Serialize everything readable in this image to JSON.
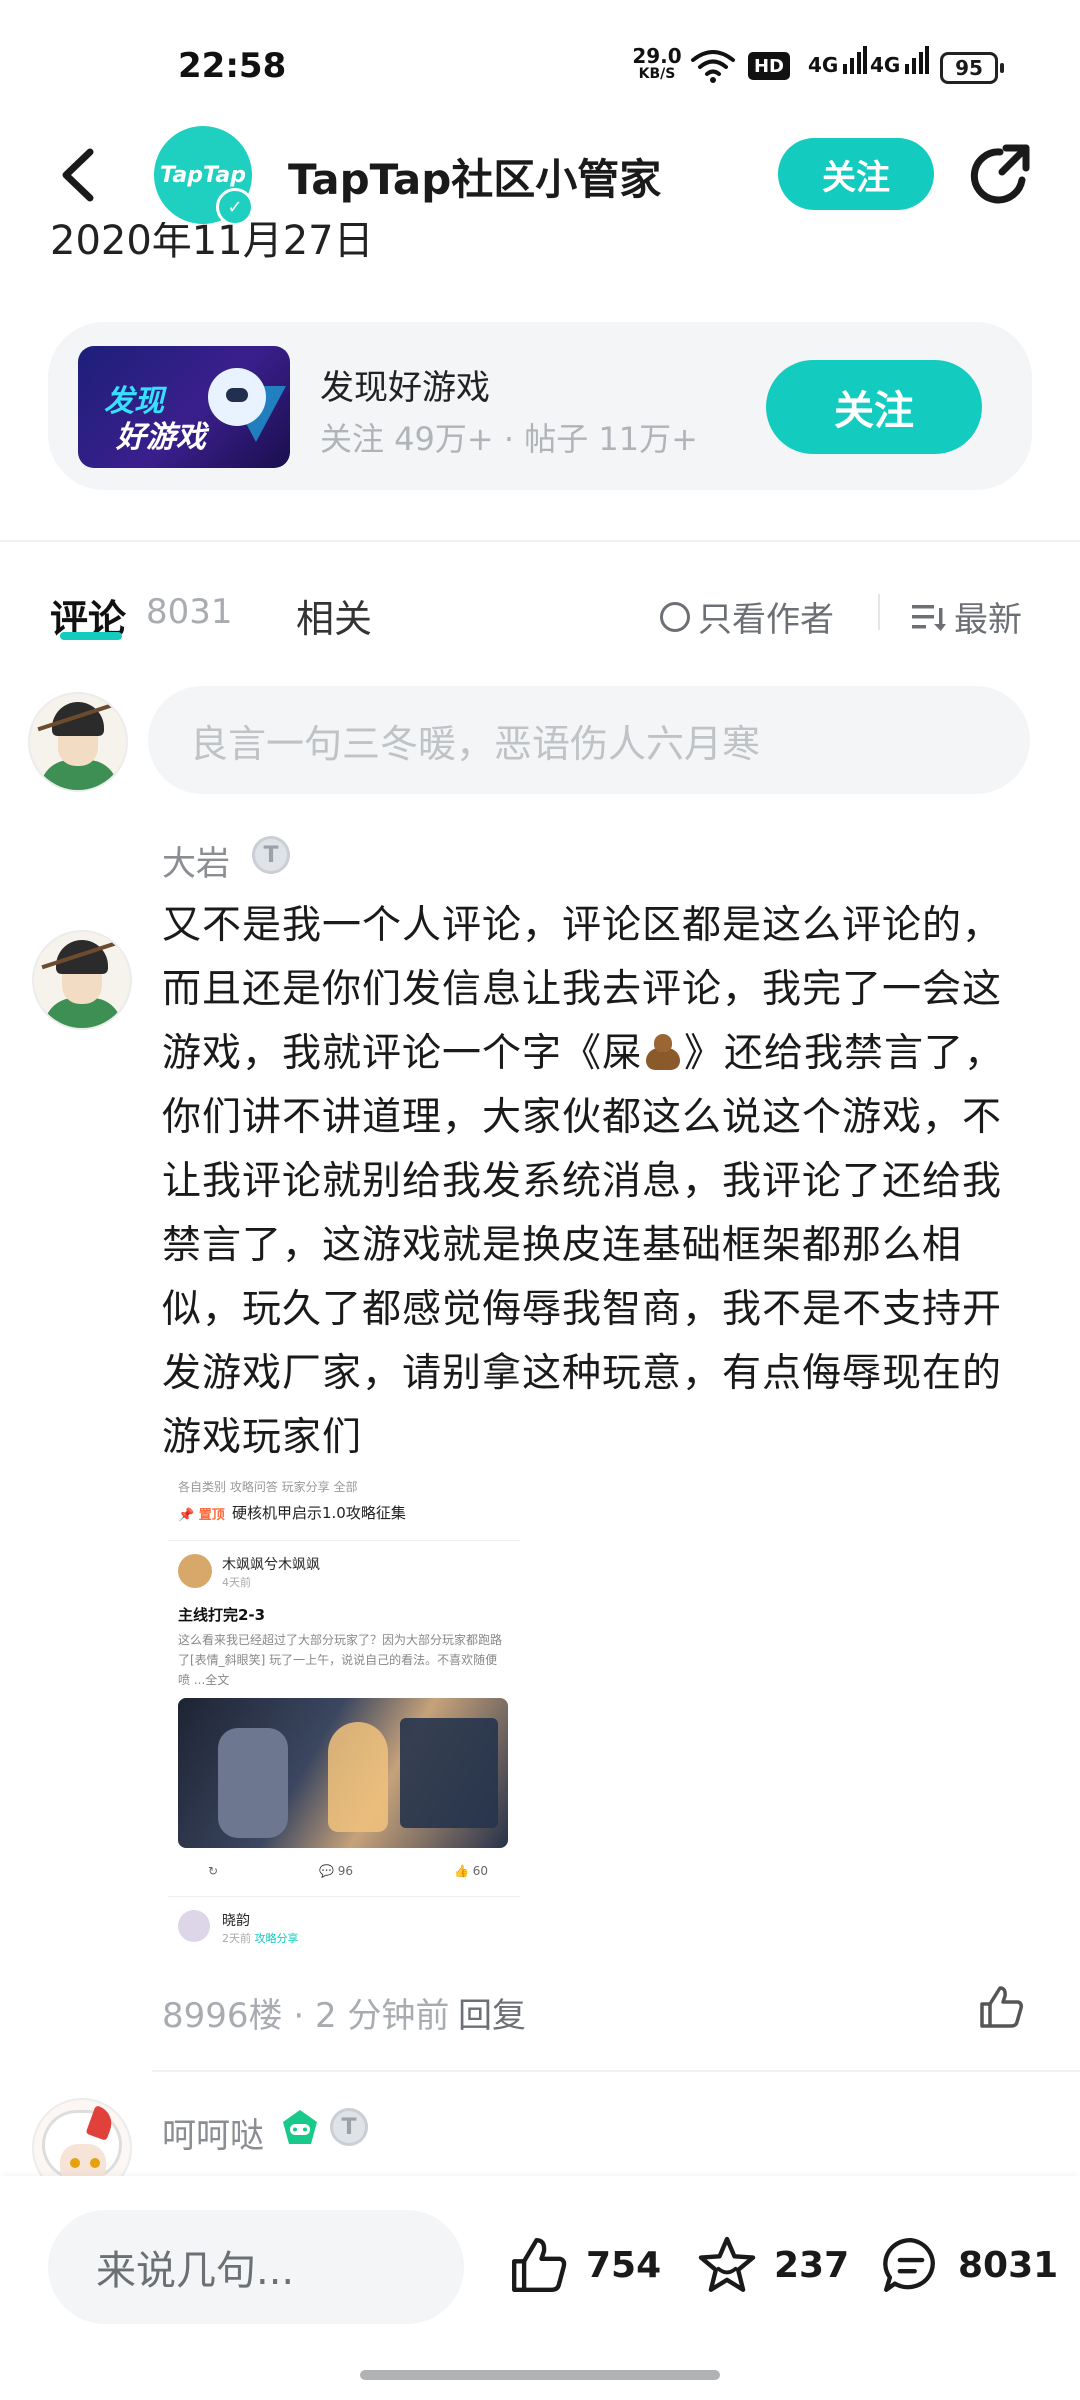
{
  "status_bar": {
    "time": "22:58",
    "net_speed": "29.0",
    "net_speed_unit": "KB/S",
    "hd_label": "HD",
    "signal_1": "4G",
    "signal_2": "4G",
    "battery": "95",
    "icons": [
      "wifi-icon",
      "signal-icon",
      "battery-icon"
    ]
  },
  "header": {
    "avatar_text": "TapTap",
    "title": "TapTap社区小管家",
    "follow_label": "关注",
    "partial_date": "2020年11月27日",
    "icons": [
      "back-arrow-icon",
      "verified-icon",
      "share-icon"
    ]
  },
  "group_card": {
    "logo_line1": "发现",
    "logo_line2": "好游戏",
    "name": "发现好游戏",
    "stats": "关注 49万+ · 帖子 11万+",
    "follow_label": "关注"
  },
  "tabs": {
    "comments_label": "评论",
    "comments_count": "8031",
    "related_label": "相关",
    "author_only_label": "只看作者",
    "sort_label": "最新",
    "accent_color": "#14cbbf"
  },
  "comment_input": {
    "placeholder": "良言一句三冬暖，恶语伤人六月寒"
  },
  "comments": [
    {
      "username": "大岩",
      "badge": "T",
      "body_before_icon": "又不是我一个人评论，评论区都是这么评论的，而且还是你们发信息让我去评论，我完了一会这游戏，我就评论一个字《屎",
      "body_after_icon": "》还给我禁言了，你们讲不讲道理，大家伙都这么说这个游戏，不让我评论就别给我发系统消息，我评论了还给我禁言了，这游戏就是换皮连基础框架都那么相似，玩久了都感觉侮辱我智商，我不是不支持开发游戏厂家，请别拿这种玩意，有点侮辱现在的游戏玩家们",
      "floor_time": "8996楼 · 2 分钟前",
      "reply_label": "回复",
      "screenshot": {
        "top_tabs": "各自类别    攻略问答    玩家分享    全部",
        "pinned_tag": "📌 置顶",
        "pinned_title": "硬核机甲启示1.0攻略征集",
        "post_user": "木飒飒兮木飒飒",
        "post_time": "4天前",
        "post_title": "主线打完2-3",
        "post_text": "这么看来我已经超过了大部分玩家了？因为大部分玩家都跑路了[表情_斜眼笑] 玩了一上午，说说自己的看法。不喜欢随便喷 ...全文",
        "comments_count": "96",
        "likes_count": "60",
        "next_user": "晓韵",
        "next_time": "2天前",
        "next_tag": "攻略分享"
      }
    },
    {
      "username": "呵呵哒",
      "badge": "T"
    }
  ],
  "bottom_bar": {
    "input_placeholder": "来说几句...",
    "likes": "754",
    "favorites": "237",
    "comments": "8031"
  }
}
